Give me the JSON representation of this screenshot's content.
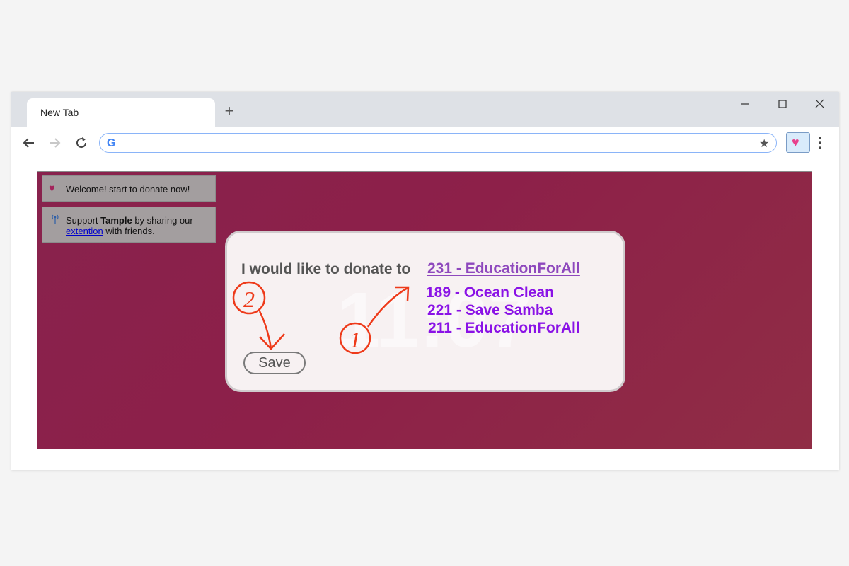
{
  "browser": {
    "tab_title": "New Tab",
    "new_tab_label": "+",
    "address_value": "",
    "google_letter": "G"
  },
  "sidebar_notices": {
    "welcome": "Welcome! start to donate now!",
    "share_prefix": "Support ",
    "share_brand": "Tample",
    "share_middle": " by sharing our ",
    "share_link": "extention",
    "share_suffix": " with friends."
  },
  "donate_dialog": {
    "prompt": "I would like to donate to",
    "selected_value": "231 - EducationForAll",
    "options": [
      "189 - Ocean Clean",
      "221 - Save Samba",
      "211 - EducationForAll"
    ],
    "save_label": "Save",
    "watermark_text": "11:07"
  },
  "annotations": {
    "step_1": "1",
    "step_2": "2",
    "color": "#ee3a1a"
  },
  "colors": {
    "page_gradient_start": "#88224d",
    "page_gradient_end": "#902d45",
    "option_text": "#8a12e6",
    "selected_text": "#8e48bd",
    "extension_heart": "#e8408c"
  }
}
